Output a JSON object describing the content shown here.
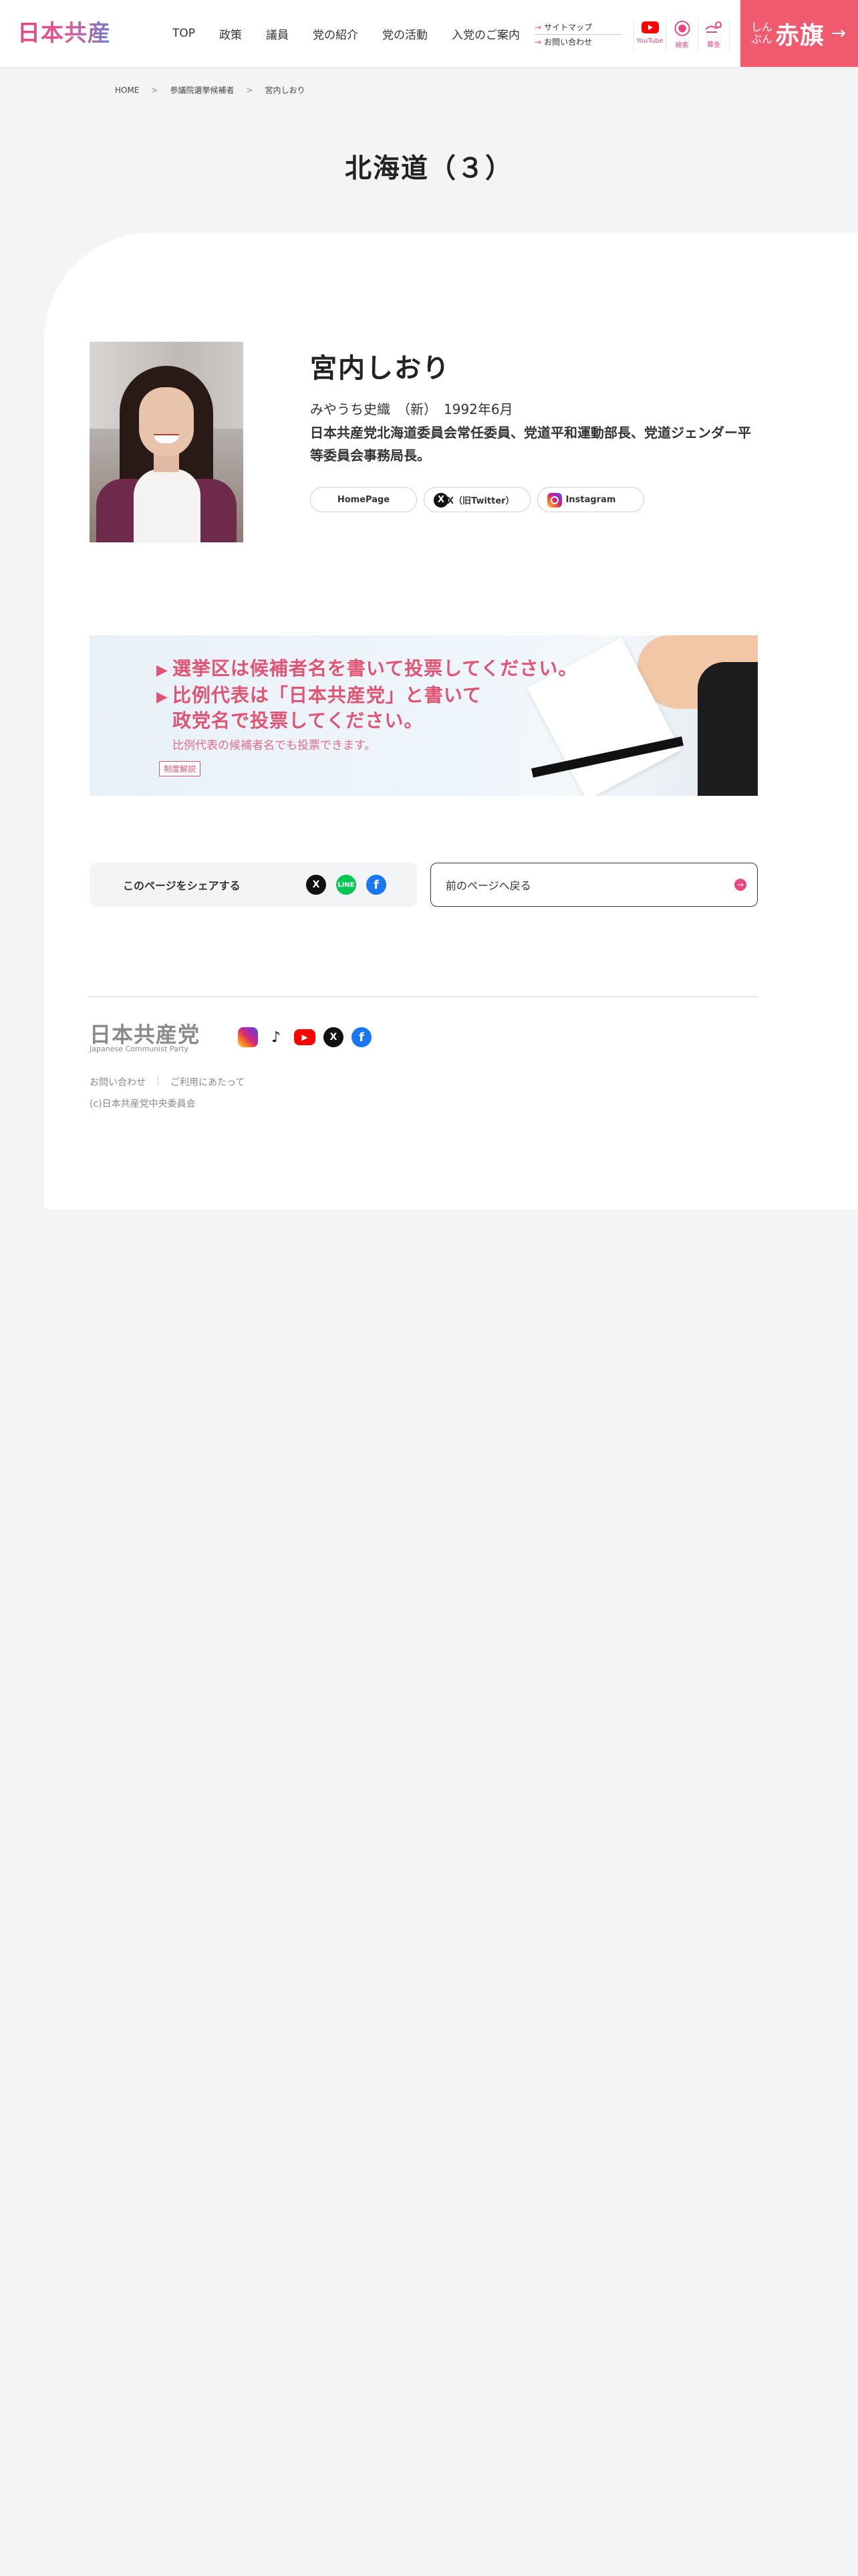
{
  "header": {
    "logo": "日本共産党",
    "nav": [
      "TOP",
      "政策",
      "議員",
      "党の紹介",
      "党の活動",
      "入党のご案内"
    ],
    "sub_links": [
      "サイトマップ",
      "お問い合わせ"
    ],
    "icons": [
      {
        "label": "YouTube",
        "icon": "youtube-icon"
      },
      {
        "label": "検索",
        "icon": "search-icon"
      },
      {
        "label": "募金",
        "icon": "donation-icon"
      }
    ],
    "akahata": {
      "small": "しんぶん",
      "big": "赤旗",
      "arrow": "→"
    }
  },
  "breadcrumb": [
    "HOME",
    "参議院選挙候補者",
    "宮内しおり"
  ],
  "breadcrumb_sep": ">",
  "page_title": "北海道（３）",
  "candidate": {
    "name": "宮内しおり",
    "kana": "みやうち史織",
    "status": "（新）",
    "born": "1992年6月",
    "description": "日本共産党北海道委員会常任委員、党道平和運動部長、党道ジェンダー平等委員会事務局長。",
    "links": [
      "HomePage",
      "X（旧Twitter）",
      "Instagram"
    ]
  },
  "banner": {
    "line1": "選挙区は候補者名を書いて投票してください。",
    "line2": "比例代表は「日本共産党」と書いて",
    "line3": "政党名で投票してください。",
    "sub": "比例代表の候補者名でも投票できます。",
    "tag": "制度解説"
  },
  "share": {
    "label": "このページをシェアする"
  },
  "back": {
    "label": "前のページへ戻る"
  },
  "footer": {
    "logo": "日本共産党",
    "logo_sub": "Japanese Communist Party",
    "links": [
      "お問い合わせ",
      "ご利用にあたって"
    ],
    "copyright": "(c)日本共産党中央委員会"
  },
  "colors": {
    "accent": "#e8467c",
    "akahata": "#f05a6e",
    "background": "#f3f4f6"
  }
}
